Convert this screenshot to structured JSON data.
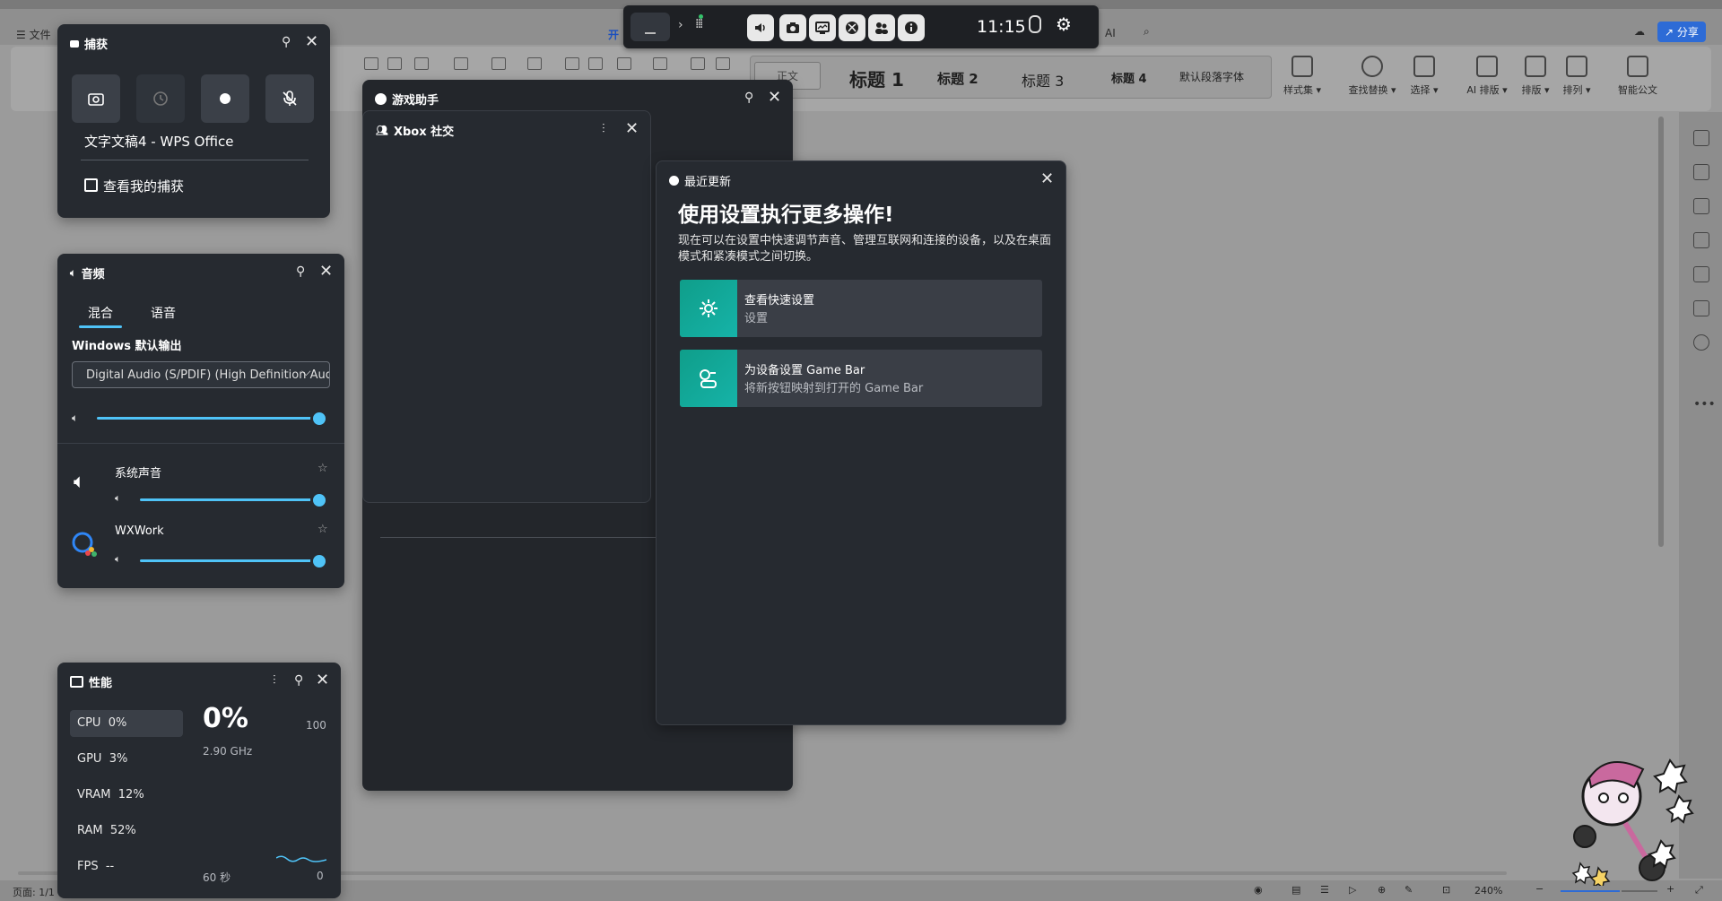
{
  "wps": {
    "menu": {
      "file": "文件"
    },
    "tab_partial": "开",
    "ai_partial": "AI",
    "share": "分享",
    "styles": {
      "normal": "正文",
      "h1": "标题 1",
      "h2": "标题 2",
      "h3": "标题 3",
      "h4": "标题 4",
      "default_para": "默认段落字体"
    },
    "tools": [
      {
        "label": "样式集"
      },
      {
        "label": "查找替换"
      },
      {
        "label": "选择"
      },
      {
        "label": "AI 排版"
      },
      {
        "label": "排版"
      },
      {
        "label": "排列"
      },
      {
        "label": "智能公文"
      }
    ],
    "status": {
      "page": "页面: 1/1",
      "zoom": "240%"
    }
  },
  "gamebar": {
    "time": "11:15"
  },
  "capture": {
    "title": "捕获",
    "target": "文字文稿4 - WPS Office",
    "view_captures": "查看我的捕获"
  },
  "audio": {
    "title": "音频",
    "tab_mix": "混合",
    "tab_voice": "语音",
    "output_label": "Windows 默认输出",
    "device": "Digital Audio (S/PDIF) (High Definition Audio Device)",
    "master_volume": 1.0,
    "apps": [
      {
        "name": "系统声音",
        "volume": 1.0
      },
      {
        "name": "WXWork",
        "volume": 1.0
      }
    ]
  },
  "performance": {
    "title": "性能",
    "rows": [
      {
        "label": "CPU",
        "value": "0%"
      },
      {
        "label": "GPU",
        "value": "3%"
      },
      {
        "label": "VRAM",
        "value": "12%"
      },
      {
        "label": "RAM",
        "value": "52%"
      },
      {
        "label": "FPS",
        "value": "--"
      }
    ],
    "big_value": "0%",
    "freq": "2.90 GHz",
    "max": "100",
    "window": "60 秒",
    "min": "0"
  },
  "game_helper": {
    "title": "游戏助手",
    "xbox_title": "Xbox 社交"
  },
  "recent_update": {
    "title": "最近更新",
    "headline": "使用设置执行更多操作!",
    "body": "现在可以在设置中快速调节声音、管理互联网和连接的设备，以及在桌面模式和紧凑模式之间切换。",
    "tiles": [
      {
        "title": "查看快速设置",
        "subtitle": "设置"
      },
      {
        "title": "为设备设置 Game Bar",
        "subtitle": "将新按钮映射到打开的 Game Bar"
      }
    ]
  },
  "colors": {
    "accent": "#4fc3f7",
    "panel_bg": "#262a30",
    "tile_accent": "#16b3a8"
  }
}
